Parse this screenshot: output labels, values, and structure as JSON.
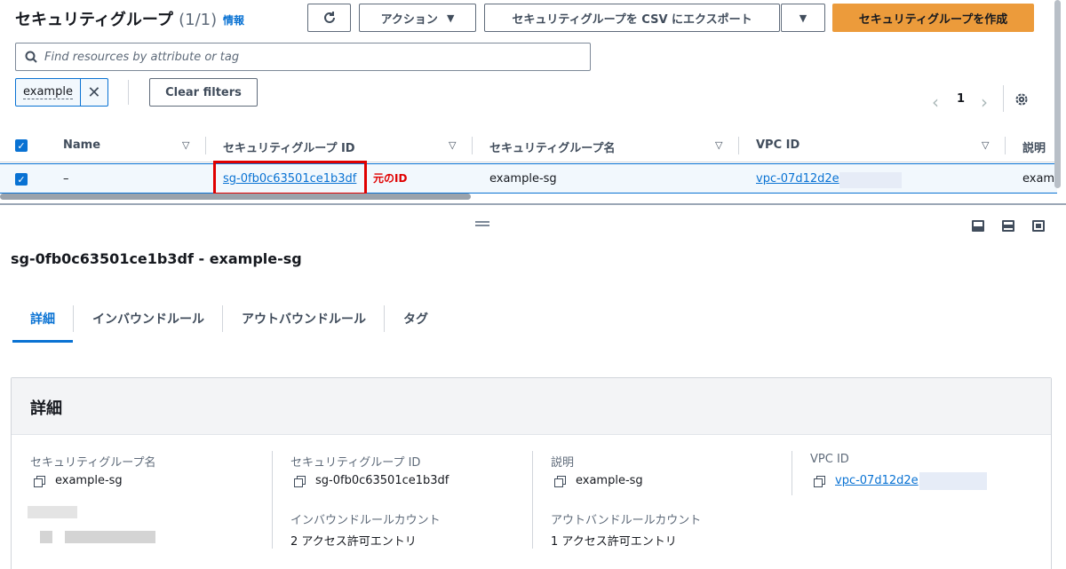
{
  "header": {
    "title": "セキュリティグループ",
    "count": "(1/1)",
    "info_link": "情報",
    "actions_label": "アクション",
    "export_label": "セキュリティグループを CSV にエクスポート",
    "create_label": "セキュリティグループを作成"
  },
  "filter": {
    "placeholder": "Find resources by attribute or tag",
    "token_value": "example",
    "clear_label": "Clear filters"
  },
  "pagination": {
    "current_page": "1"
  },
  "table": {
    "columns": [
      "Name",
      "セキュリティグループ ID",
      "セキュリティグループ名",
      "VPC ID",
      "説明"
    ],
    "rows": [
      {
        "name": "–",
        "sg_id": "sg-0fb0c63501ce1b3df",
        "sg_name": "example-sg",
        "vpc_id": "vpc-07d12d2e",
        "description": "exam"
      }
    ]
  },
  "annotation": {
    "text": "元のID",
    "color": "#e00000"
  },
  "detail": {
    "title": "sg-0fb0c63501ce1b3df - example-sg",
    "tabs": [
      "詳細",
      "インバウンドルール",
      "アウトバウンドルール",
      "タグ"
    ],
    "active_tab": "詳細",
    "section_title": "詳細",
    "fields": {
      "sg_name_label": "セキュリティグループ名",
      "sg_name_value": "example-sg",
      "sg_id_label": "セキュリティグループ ID",
      "sg_id_value": "sg-0fb0c63501ce1b3df",
      "description_label": "説明",
      "description_value": "example-sg",
      "vpc_id_label": "VPC ID",
      "vpc_id_value": "vpc-07d12d2e",
      "inbound_count_label": "インバウンドルールカウント",
      "inbound_count_value": "2 アクセス許可エントリ",
      "outbound_count_label": "アウトバンドルールカウント",
      "outbound_count_value": "1 アクセス許可エントリ"
    }
  },
  "colors": {
    "accent": "#0972d3",
    "primary_button": "#ec9b3b",
    "highlight": "#e00000"
  },
  "icons": [
    "refresh-icon",
    "caret-down-icon",
    "search-icon",
    "close-icon",
    "chevron-left-icon",
    "chevron-right-icon",
    "gear-icon",
    "checkbox-icon",
    "copy-icon",
    "drag-handle-icon",
    "layout-icon"
  ]
}
